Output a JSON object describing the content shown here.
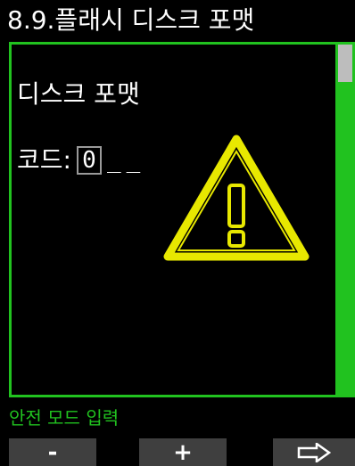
{
  "header": {
    "title": "8.9.플래시 디스크 포맷"
  },
  "main": {
    "heading": "디스크 포맷",
    "code_label": "코드:",
    "code_digit": "0",
    "code_blanks": [
      "_",
      "_"
    ],
    "warning_icon": "warning-icon"
  },
  "status": {
    "text": "안전 모드 입력"
  },
  "buttons": {
    "minus_label": "-",
    "plus_label": "+",
    "next_icon": "arrow-right-icon"
  },
  "colors": {
    "accent": "#21c21f",
    "warning": "#e8e800",
    "button_bg": "#3f3f3f",
    "background": "#000000"
  }
}
